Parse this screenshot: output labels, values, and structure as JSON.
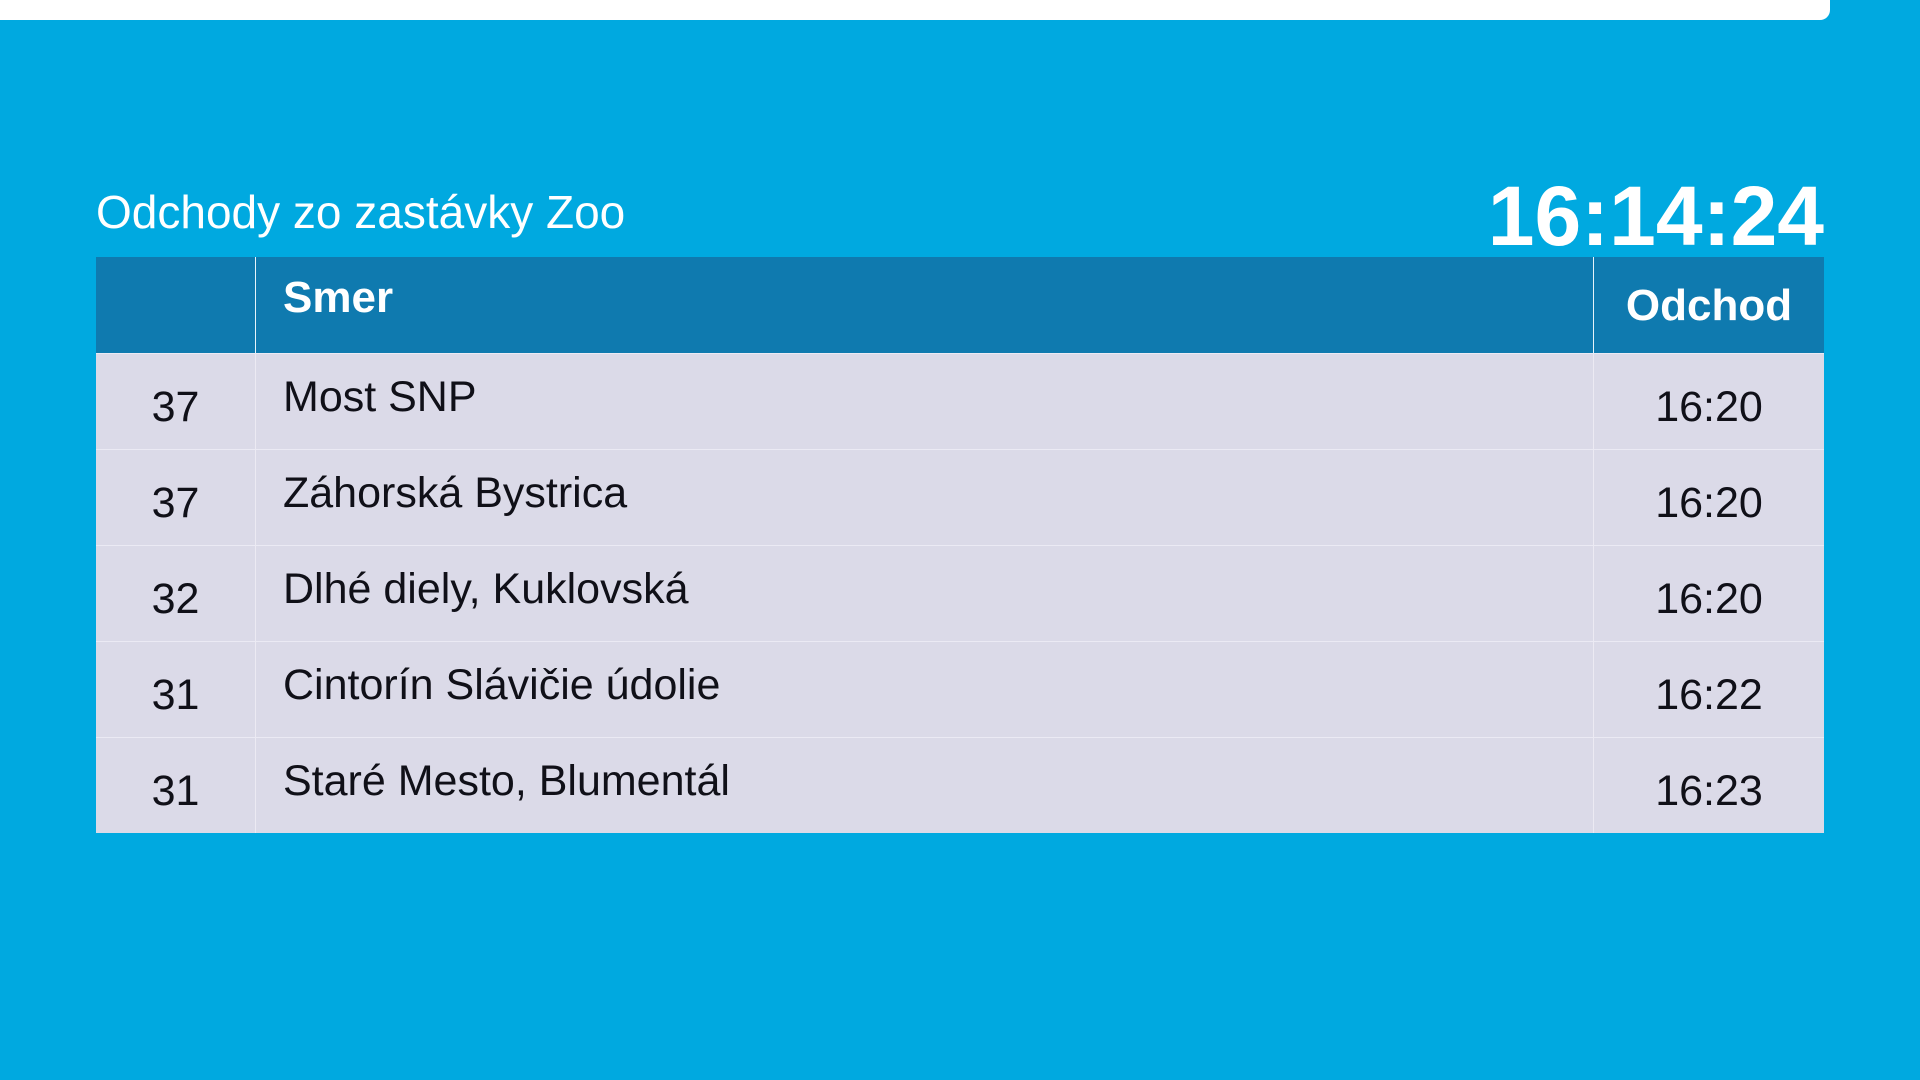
{
  "title": "Odchody zo zastávky Zoo",
  "clock": "16:14:24",
  "table": {
    "headers": {
      "line": "",
      "direction": "Smer",
      "departure": "Odchod"
    },
    "rows": [
      {
        "line": "37",
        "direction": "Most SNP",
        "departure": "16:20"
      },
      {
        "line": "37",
        "direction": "Záhorská Bystrica",
        "departure": "16:20"
      },
      {
        "line": "32",
        "direction": "Dlhé diely, Kuklovská",
        "departure": "16:20"
      },
      {
        "line": "31",
        "direction": "Cintorín Slávičie údolie",
        "departure": "16:22"
      },
      {
        "line": "31",
        "direction": "Staré Mesto, Blumentál",
        "departure": "16:23"
      }
    ]
  },
  "colors": {
    "background": "#00a9e0",
    "header": "#0f7aaf",
    "row": "#dbdae8"
  }
}
